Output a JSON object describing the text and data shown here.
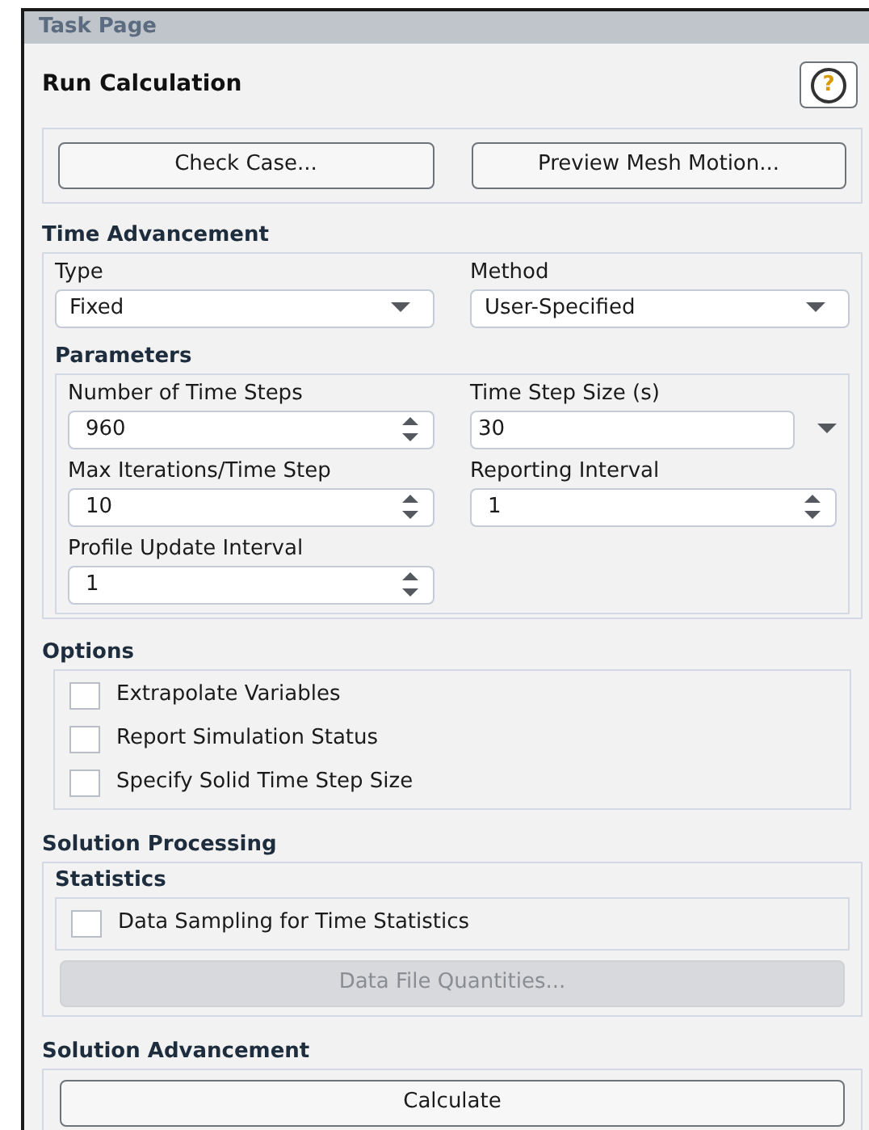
{
  "title": "Task Page",
  "heading": "Run Calculation",
  "help_button": {
    "label": "?"
  },
  "top_buttons": [
    {
      "label": "Check Case..."
    },
    {
      "label": "Preview Mesh Motion..."
    }
  ],
  "time_advancement": {
    "title": "Time Advancement",
    "fields": [
      {
        "label": "Type",
        "value": "Fixed",
        "kind": "dropdown"
      },
      {
        "label": "Method",
        "value": "User-Specified",
        "kind": "dropdown"
      }
    ],
    "parameters": {
      "title": "Parameters",
      "fields": [
        {
          "label": "Number of Time Steps",
          "value": "960",
          "kind": "spinner"
        },
        {
          "label": "Time Step Size (s)",
          "value": "30",
          "kind": "combo"
        },
        {
          "label": "Max Iterations/Time Step",
          "value": "10",
          "kind": "spinner"
        },
        {
          "label": "Reporting Interval",
          "value": "1",
          "kind": "spinner"
        },
        {
          "label": "Profile Update Interval",
          "value": "1",
          "kind": "spinner"
        }
      ]
    }
  },
  "options": {
    "title": "Options",
    "items": [
      {
        "label": "Extrapolate Variables",
        "checked": false
      },
      {
        "label": "Report Simulation Status",
        "checked": false
      },
      {
        "label": "Specify Solid Time Step Size",
        "checked": false
      }
    ]
  },
  "solution_processing": {
    "title": "Solution Processing",
    "statistics": {
      "title": "Statistics",
      "items": [
        {
          "label": "Data Sampling for Time Statistics",
          "checked": false
        }
      ],
      "button": {
        "label": "Data File Quantities...",
        "disabled": true
      }
    }
  },
  "solution_advancement": {
    "title": "Solution Advancement",
    "button": {
      "label": "Calculate",
      "disabled": false
    }
  }
}
